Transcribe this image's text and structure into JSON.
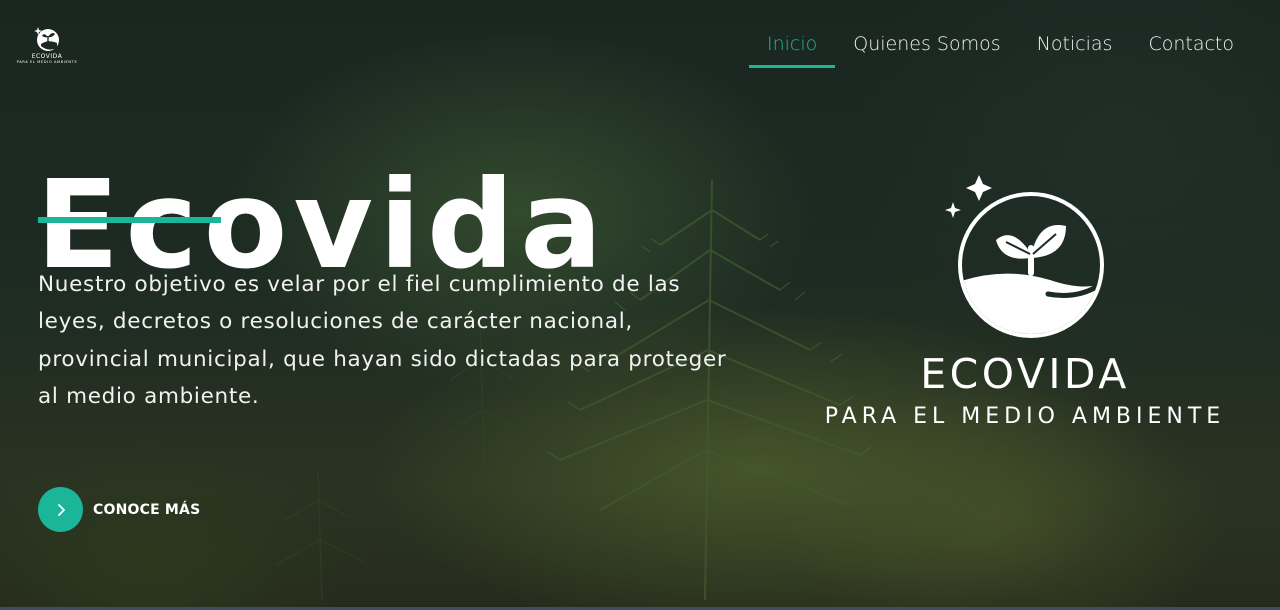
{
  "brand": {
    "logo_title": "ECOVIDA",
    "logo_subtitle": "PARA EL MEDIO AMBIENTE"
  },
  "nav": {
    "items": [
      {
        "label": "Inicio",
        "active": true
      },
      {
        "label": "Quienes Somos",
        "active": false
      },
      {
        "label": "Noticias",
        "active": false
      },
      {
        "label": "Contacto",
        "active": false
      }
    ]
  },
  "hero": {
    "title": "Ecovida",
    "description": "Nuestro objetivo es velar por el fiel cumplimiento de las leyes, decretos o resoluciones de carácter nacional, provincial municipal, que hayan sido dictadas para proteger al medio ambiente.",
    "cta_label": "CONOCE MÁS",
    "cta_icon": "chevron-right-icon"
  },
  "badge": {
    "title": "ECOVIDA",
    "subtitle": "PARA EL MEDIO AMBIENTE",
    "icon": "sprout-icon"
  },
  "colors": {
    "accent": "#1bb59a",
    "text": "#ffffff",
    "background": "#1d2b22"
  }
}
